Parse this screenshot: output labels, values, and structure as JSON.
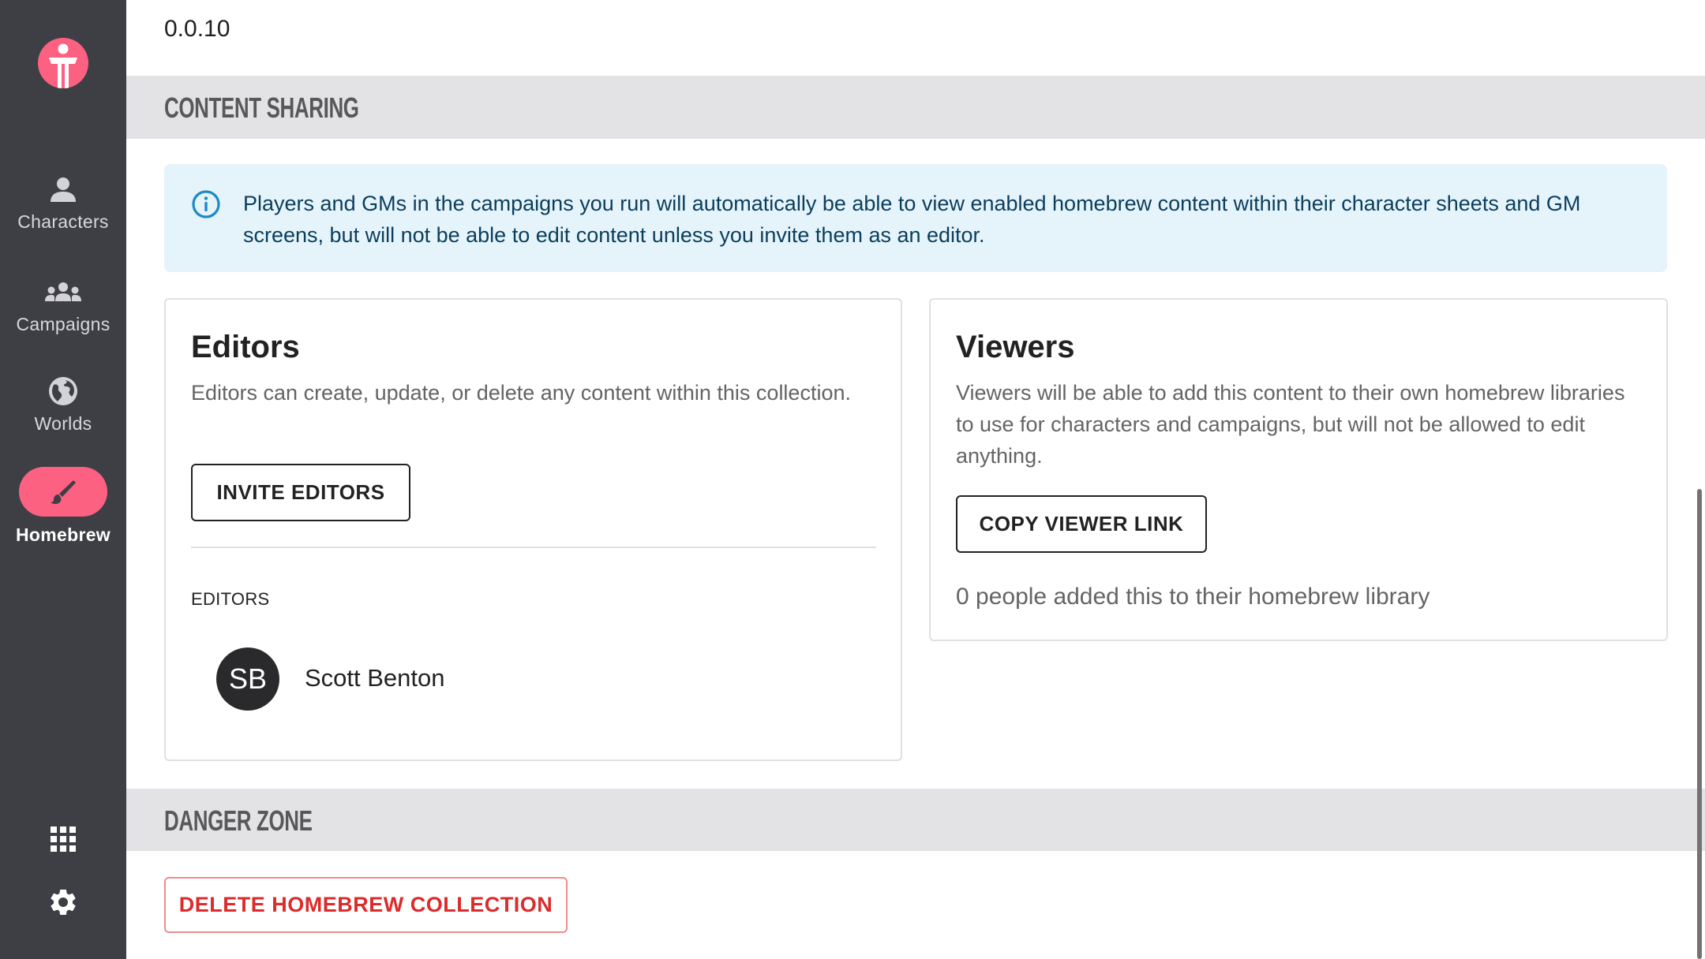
{
  "sidebar": {
    "logo": "app-logo",
    "items": [
      {
        "label": "Characters",
        "icon": "person-icon",
        "active": false
      },
      {
        "label": "Campaigns",
        "icon": "group-icon",
        "active": false
      },
      {
        "label": "Worlds",
        "icon": "globe-icon",
        "active": false
      },
      {
        "label": "Homebrew",
        "icon": "brush-icon",
        "active": true
      }
    ],
    "bottom": [
      {
        "icon": "apps-grid-icon"
      },
      {
        "icon": "gear-icon"
      }
    ]
  },
  "main": {
    "version": "0.0.10",
    "content_sharing": {
      "title": "CONTENT SHARING",
      "banner_text": "Players and GMs in the campaigns you run will automatically be able to view enabled homebrew content within their character sheets and GM screens, but will not be able to edit content unless you invite them as an editor.",
      "editors": {
        "title": "Editors",
        "description": "Editors can create, update, or delete any content within this collection.",
        "invite_button": "INVITE EDITORS",
        "list_label": "EDITORS",
        "list": [
          {
            "initials": "SB",
            "name": "Scott Benton"
          }
        ]
      },
      "viewers": {
        "title": "Viewers",
        "description": "Viewers will be able to add this content to their own homebrew libraries to use for characters and campaigns, but will not be allowed to edit anything.",
        "copy_button": "COPY VIEWER LINK",
        "count_text": "0 people added this to their homebrew library"
      }
    },
    "danger_zone": {
      "title": "DANGER ZONE",
      "delete_button": "DELETE HOMEBREW COLLECTION"
    }
  },
  "colors": {
    "sidebar_bg": "#3e3f45",
    "brand_accent": "#fd6181",
    "banner_bg": "#e5f4fb",
    "info_blue": "#1e88c8",
    "danger_red": "#dc2b2b",
    "section_band": "#e3e3e6"
  }
}
